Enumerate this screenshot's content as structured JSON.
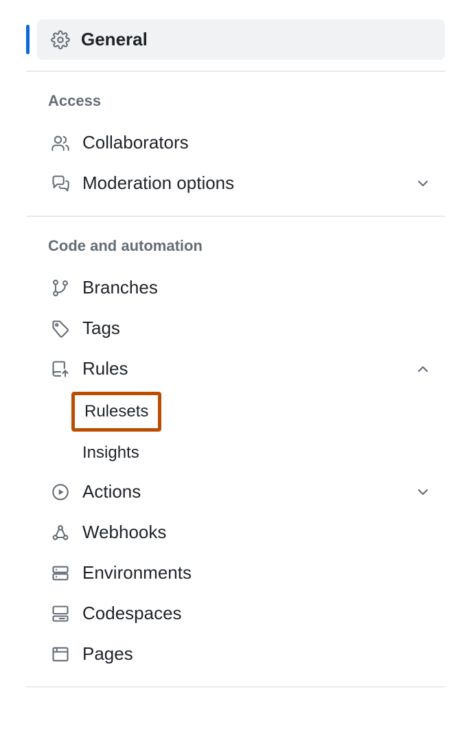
{
  "general": {
    "label": "General"
  },
  "sections": {
    "access": {
      "title": "Access",
      "collaborators": "Collaborators",
      "moderation": "Moderation options"
    },
    "code": {
      "title": "Code and automation",
      "branches": "Branches",
      "tags": "Tags",
      "rules": "Rules",
      "rules_sub": {
        "rulesets": "Rulesets",
        "insights": "Insights"
      },
      "actions": "Actions",
      "webhooks": "Webhooks",
      "environments": "Environments",
      "codespaces": "Codespaces",
      "pages": "Pages"
    }
  },
  "highlight_color": "#bc4c00"
}
